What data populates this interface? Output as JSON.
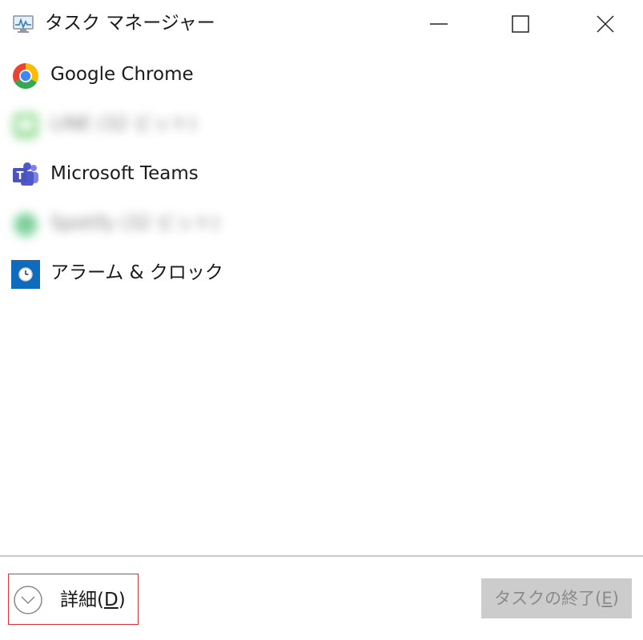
{
  "window": {
    "title": "タスク マネージャー",
    "icon": "task-manager-icon"
  },
  "title_controls": {
    "minimize_icon": "minimize-icon",
    "maximize_icon": "maximize-icon",
    "close_icon": "close-icon"
  },
  "processes": [
    {
      "label": "Google Chrome",
      "icon": "chrome-icon",
      "obscured": false
    },
    {
      "label": "LINE (32 ビット)",
      "icon": "line-icon",
      "obscured": true
    },
    {
      "label": "Microsoft Teams",
      "icon": "teams-icon",
      "obscured": false
    },
    {
      "label": "Spotify (32 ビット)",
      "icon": "spotify-icon",
      "obscured": true
    },
    {
      "label": "アラーム & クロック",
      "icon": "alarm-clock-icon",
      "obscured": false
    }
  ],
  "footer": {
    "details_label": "詳細(",
    "details_mnemonic": "D",
    "details_close": ")",
    "end_task_label": "タスクの終了(",
    "end_task_mnemonic": "E",
    "end_task_close": ")"
  },
  "colors": {
    "highlight_border": "#e0303a",
    "disabled_button_bg": "#cccccc",
    "disabled_button_text": "#8a8a8a",
    "teams_purple": "#5059c9",
    "alarm_blue": "#0f6cbd"
  }
}
